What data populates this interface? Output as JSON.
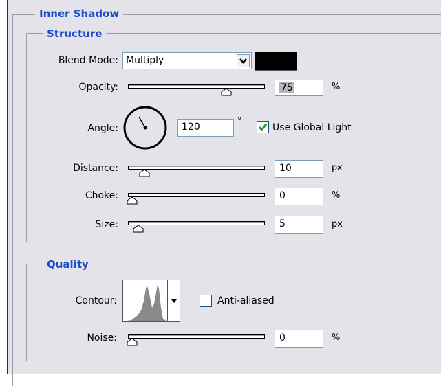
{
  "inner_shadow": {
    "title": "Inner Shadow"
  },
  "structure": {
    "title": "Structure",
    "blend_mode": {
      "label": "Blend Mode:",
      "value": "Multiply",
      "swatch_color": "#000000"
    },
    "opacity": {
      "label": "Opacity:",
      "value": "75",
      "unit": "%",
      "level": 0.75
    },
    "angle": {
      "label": "Angle:",
      "value": "120",
      "unit": "°",
      "use_global_light": {
        "label": "Use Global Light",
        "checked": true
      }
    },
    "distance": {
      "label": "Distance:",
      "value": "10",
      "unit": "px",
      "level": 0.1
    },
    "choke": {
      "label": "Choke:",
      "value": "0",
      "unit": "%",
      "level": 0
    },
    "size": {
      "label": "Size:",
      "value": "5",
      "unit": "px",
      "level": 0.05
    }
  },
  "quality": {
    "title": "Quality",
    "contour": {
      "label": "Contour:"
    },
    "anti_aliased": {
      "label": "Anti-aliased",
      "checked": false
    },
    "noise": {
      "label": "Noise:",
      "value": "0",
      "unit": "%",
      "level": 0
    }
  },
  "colors": {
    "accent": "#1a4cc8",
    "panel": "#e4e3ea",
    "check": "#21a121"
  }
}
